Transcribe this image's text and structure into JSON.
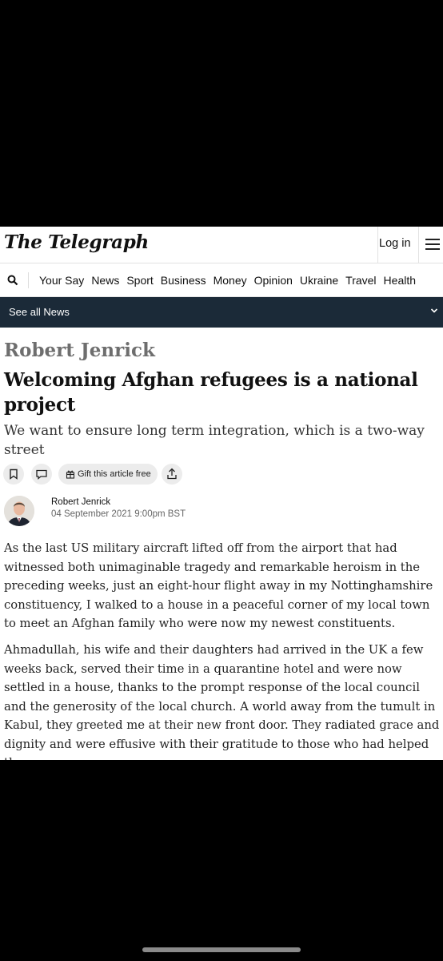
{
  "masthead": {
    "logo": "The Telegraph",
    "login_label": "Log in"
  },
  "nav": {
    "items": [
      "Your Say",
      "News",
      "Sport",
      "Business",
      "Money",
      "Opinion",
      "Ukraine",
      "Travel",
      "Health"
    ]
  },
  "section_bar": {
    "label": "See all News"
  },
  "article": {
    "author_kicker": "Robert Jenrick",
    "headline": "Welcoming Afghan refugees is a national project",
    "standfirst": "We want to ensure long term integration, which is a two-way street",
    "gift_label": "Gift this article free",
    "byline_name": "Robert Jenrick",
    "byline_date": "04 September 2021 9:00pm BST",
    "paragraphs": [
      "As the last US military aircraft lifted off from the airport that had witnessed both unimaginable tragedy and remarkable heroism in the preceding weeks, just an eight-hour flight away in my Nottinghamshire constituency, I walked to a house in a peaceful corner of my local town to meet an Afghan family who were now my newest constituents.",
      "Ahmadullah, his wife and their daughters had arrived in the UK a few weeks back, served their time in a quarantine hotel and were now settled in a house, thanks to the prompt response of the local council and the generosity of the local church. A world away from the tumult in Kabul, they greeted me at their new front door. They radiated grace and dignity and were effusive with their gratitude to those who had helped them."
    ]
  },
  "colors": {
    "section_bar_bg": "#1b2a38",
    "kicker_grey": "#6e6e6e"
  }
}
